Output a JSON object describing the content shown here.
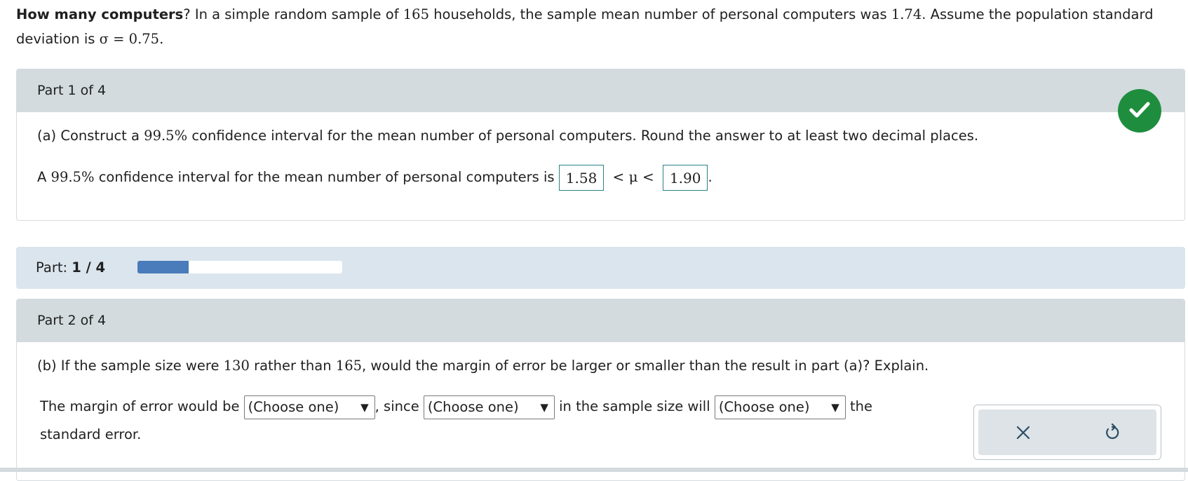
{
  "problem": {
    "title_bold": "How many computers",
    "text_1": "? In a simple random sample of ",
    "n": "165",
    "text_2": " households, the sample mean number of personal computers was ",
    "mean": "1.74",
    "text_3": ". Assume the population standard deviation is ",
    "sigma": "σ = 0.75",
    "text_4": "."
  },
  "part1": {
    "header": "Part 1 of 4",
    "question_a": "(a) Construct a ",
    "conf_level": "99.5%",
    "question_b": " confidence interval for the mean number of personal computers. Round the answer to at least two decimal places.",
    "answer_pre_a": "A ",
    "answer_pre_b": " confidence interval for the mean number of personal computers is",
    "lower": "1.58",
    "middle": "< μ <",
    "upper": "1.90",
    "end": "."
  },
  "progress": {
    "label": "Part:",
    "value": "1 / 4",
    "fraction": 0.25
  },
  "part2": {
    "header": "Part 2 of 4",
    "question_a": "(b) If the sample size were ",
    "n_new": "130",
    "question_b": " rather than ",
    "n_old": "165",
    "question_c": ", would the margin of error be larger or smaller than the result in part (a)? Explain.",
    "sentence_1": "The margin of error would be",
    "sentence_2": ", since",
    "sentence_3": "in the sample size will",
    "sentence_4": "the",
    "sentence_5": "standard error.",
    "select_1": "(Choose one)",
    "select_2": "(Choose one)",
    "select_3": "(Choose one)",
    "arrow": "▼"
  },
  "icons": {
    "check": "check-icon",
    "close": "close-icon",
    "undo": "undo-icon"
  },
  "colors": {
    "success": "#1e8e3e",
    "progress_fill": "#4a7bba",
    "answer_border": "#2a8286"
  }
}
